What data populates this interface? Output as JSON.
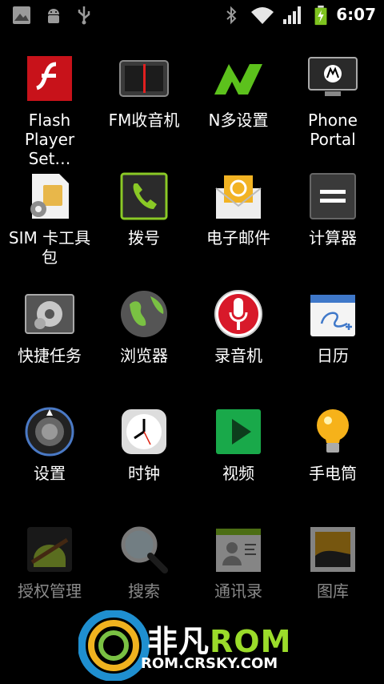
{
  "status_bar": {
    "time": "6:07",
    "left_icons": [
      "gallery-notification-icon",
      "android-debug-icon",
      "usb-icon"
    ],
    "right_icons": [
      "bluetooth-icon",
      "wifi-icon",
      "signal-icon",
      "battery-charging-icon"
    ]
  },
  "apps": [
    {
      "label": "Flash Player Set…",
      "icon": "flash-player-icon"
    },
    {
      "label": "FM收音机",
      "icon": "fm-radio-icon"
    },
    {
      "label": "N多设置",
      "icon": "n-settings-icon"
    },
    {
      "label": "Phone Portal",
      "icon": "phone-portal-icon"
    },
    {
      "label": "SIM 卡工具包",
      "icon": "sim-toolkit-icon"
    },
    {
      "label": "拨号",
      "icon": "phone-dialer-icon"
    },
    {
      "label": "电子邮件",
      "icon": "email-icon"
    },
    {
      "label": "计算器",
      "icon": "calculator-icon"
    },
    {
      "label": "快捷任务",
      "icon": "quick-tasks-icon"
    },
    {
      "label": "浏览器",
      "icon": "browser-globe-icon"
    },
    {
      "label": "录音机",
      "icon": "voice-recorder-icon"
    },
    {
      "label": "日历",
      "icon": "calendar-icon"
    },
    {
      "label": "设置",
      "icon": "settings-knob-icon"
    },
    {
      "label": "时钟",
      "icon": "clock-icon"
    },
    {
      "label": "视频",
      "icon": "video-play-icon"
    },
    {
      "label": "手电筒",
      "icon": "flashlight-bulb-icon"
    },
    {
      "label": "授权管理",
      "icon": "superuser-android-icon"
    },
    {
      "label": "搜索",
      "icon": "search-magnifier-icon"
    },
    {
      "label": "通讯录",
      "icon": "contacts-icon"
    },
    {
      "label": "图库",
      "icon": "gallery-icon"
    }
  ],
  "watermark": {
    "brand_prefix": "非凡",
    "brand_suffix": "ROM",
    "url": "ROM.CRSKY.COM"
  }
}
